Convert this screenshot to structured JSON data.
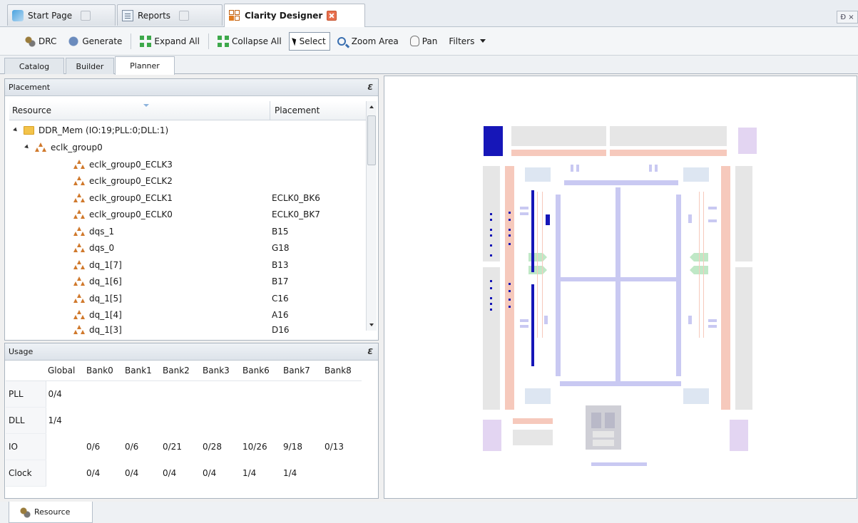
{
  "doc_tabs": [
    {
      "label": "Start Page",
      "icon": "start-page-icon"
    },
    {
      "label": "Reports",
      "icon": "report-icon"
    },
    {
      "label": "Clarity Designer",
      "icon": "clarity-designer-icon",
      "active": true
    }
  ],
  "window_controls": {
    "label": "Ɖ ×"
  },
  "toolbar": {
    "drc": "DRC",
    "generate": "Generate",
    "expand_all": "Expand All",
    "collapse_all": "Collapse All",
    "select": "Select",
    "zoom_area": "Zoom Area",
    "pan": "Pan",
    "filters": "Filters"
  },
  "view_tabs": [
    "Catalog",
    "Builder",
    "Planner"
  ],
  "placement_panel": {
    "title": "Placement",
    "col_resource": "Resource",
    "col_placement": "Placement",
    "rows": [
      {
        "label": "DDR_Mem (IO:19;PLL:0;DLL:1)",
        "placement": ""
      },
      {
        "label": "eclk_group0",
        "placement": ""
      },
      {
        "label": "eclk_group0_ECLK3",
        "placement": ""
      },
      {
        "label": "eclk_group0_ECLK2",
        "placement": ""
      },
      {
        "label": "eclk_group0_ECLK1",
        "placement": "ECLK0_BK6"
      },
      {
        "label": "eclk_group0_ECLK0",
        "placement": "ECLK0_BK7"
      },
      {
        "label": "dqs_1",
        "placement": "B15"
      },
      {
        "label": "dqs_0",
        "placement": "G18"
      },
      {
        "label": "dq_1[7]",
        "placement": "B13"
      },
      {
        "label": "dq_1[6]",
        "placement": "B17"
      },
      {
        "label": "dq_1[5]",
        "placement": "C16"
      },
      {
        "label": "dq_1[4]",
        "placement": "A16"
      },
      {
        "label": "dq_1[3]",
        "placement": "D16"
      }
    ]
  },
  "usage_panel": {
    "title": "Usage",
    "columns": [
      "",
      "Global",
      "Bank0",
      "Bank1",
      "Bank2",
      "Bank3",
      "Bank6",
      "Bank7",
      "Bank8"
    ],
    "rows": [
      [
        "PLL",
        "0/4",
        "",
        "",
        "",
        "",
        "",
        "",
        ""
      ],
      [
        "DLL",
        "1/4",
        "",
        "",
        "",
        "",
        "",
        "",
        ""
      ],
      [
        "IO",
        "",
        "0/6",
        "0/6",
        "0/21",
        "0/28",
        "10/26",
        "9/18",
        "0/13"
      ],
      [
        "Clock",
        "",
        "0/4",
        "0/4",
        "0/4",
        "0/4",
        "1/4",
        "1/4",
        ""
      ]
    ]
  },
  "bottom_tabs": [
    {
      "label": "Resource"
    }
  ],
  "colors": {
    "bank_fill": "#e6e6e6",
    "io_pad": "#f6c9bc",
    "block": "#c9c9f2",
    "selected_block": "#1616b8",
    "corner": "#e3d5f2",
    "pll": "#dde6f2",
    "dll": "#bfe8c6",
    "accent": "#e8704f"
  }
}
